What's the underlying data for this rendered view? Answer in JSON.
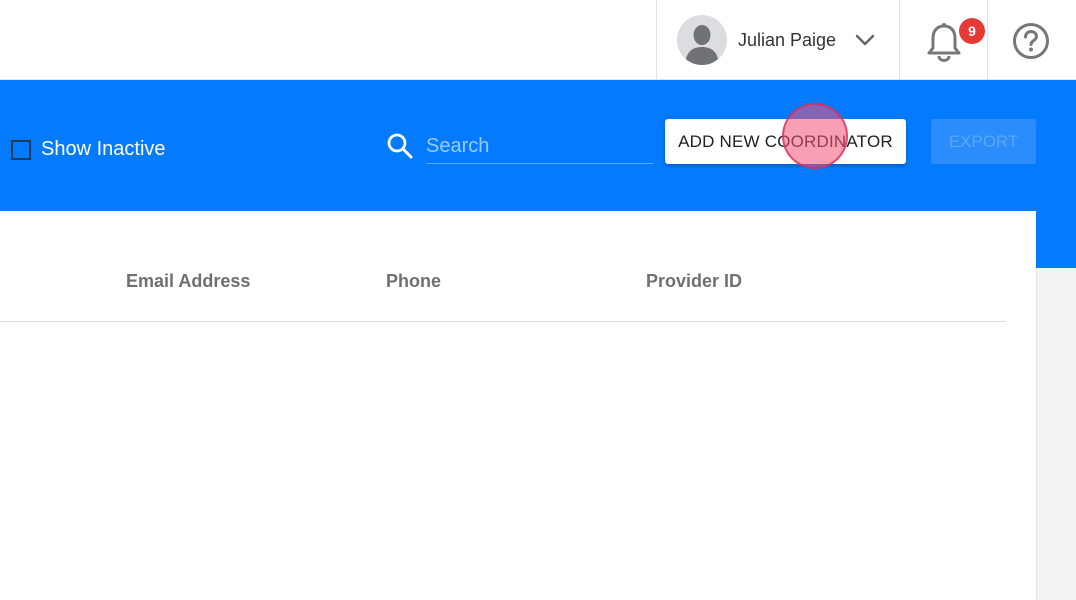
{
  "header": {
    "user": {
      "name": "Julian Paige",
      "avatar_icon": "user-avatar-icon",
      "dropdown_icon": "chevron-down-icon"
    },
    "notifications": {
      "icon": "bell-icon",
      "count": "9"
    },
    "help": {
      "icon": "help-circle-icon"
    }
  },
  "toolbar": {
    "show_inactive_label": "Show Inactive",
    "show_inactive_checked": false,
    "search": {
      "placeholder": "Search",
      "value": "",
      "icon": "search-icon"
    },
    "add_button_label": "ADD NEW COORDINATOR",
    "export_button_label": "EXPORT"
  },
  "table": {
    "columns": [
      "Email Address",
      "Phone",
      "Provider ID"
    ],
    "rows": []
  },
  "colors": {
    "primary_blue": "#047bfe",
    "badge_red": "#e53935",
    "header_text": "#707070"
  }
}
